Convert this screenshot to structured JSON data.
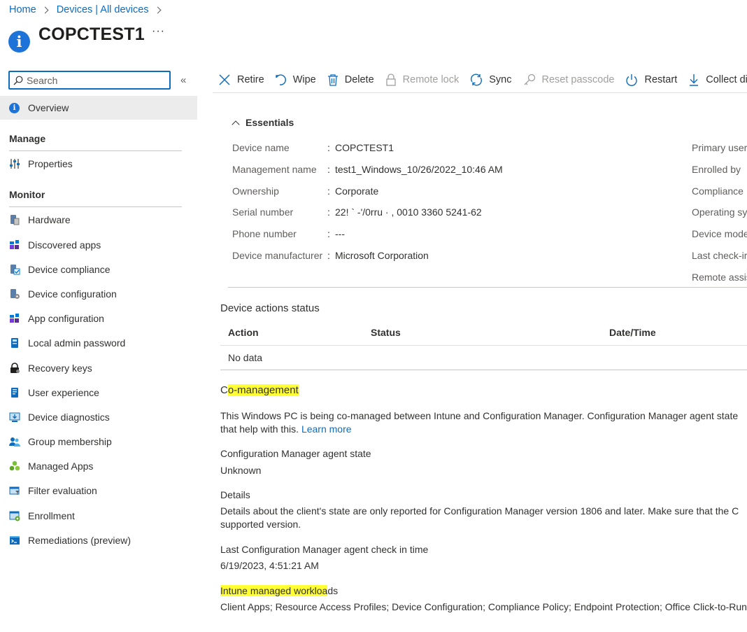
{
  "breadcrumb": {
    "home": "Home",
    "devices": "Devices | All devices"
  },
  "title": "COPCTEST1",
  "more_label": "···",
  "search": {
    "placeholder": "Search"
  },
  "collapse_label": "«",
  "sidebar": {
    "overview": "Overview",
    "manage_label": "Manage",
    "manage_items": [
      "Properties"
    ],
    "monitor_label": "Monitor",
    "monitor_items": [
      "Hardware",
      "Discovered apps",
      "Device compliance",
      "Device configuration",
      "App configuration",
      "Local admin password",
      "Recovery keys",
      "User experience",
      "Device diagnostics",
      "Group membership",
      "Managed Apps",
      "Filter evaluation",
      "Enrollment",
      "Remediations (preview)"
    ]
  },
  "commands": {
    "retire": "Retire",
    "wipe": "Wipe",
    "delete": "Delete",
    "remote_lock": "Remote lock",
    "sync": "Sync",
    "reset_passcode": "Reset passcode",
    "restart": "Restart",
    "collect": "Collect dia"
  },
  "essentials": {
    "heading": "Essentials",
    "rows": [
      {
        "key": "Device name",
        "value": "COPCTEST1"
      },
      {
        "key": "Management name",
        "value": "test1_Windows_10/26/2022_10:46 AM"
      },
      {
        "key": "Ownership",
        "value": "Corporate"
      },
      {
        "key": "Serial number",
        "value": "22! ` -'/0rru · , 0010 3360 5241-62"
      },
      {
        "key": "Phone number",
        "value": "---"
      },
      {
        "key": "Device manufacturer",
        "value": "Microsoft Corporation"
      }
    ],
    "right": [
      "Primary user",
      "Enrolled by",
      "Compliance",
      "Operating sy",
      "Device mode",
      "Last check-ir",
      "Remote assis"
    ]
  },
  "actions_status": {
    "heading": "Device actions status",
    "columns": [
      "Action",
      "Status",
      "Date/Time"
    ],
    "empty": "No data"
  },
  "comanagement": {
    "heading_prefix": "C",
    "heading_highlight": "o-management",
    "description_line1": "This Windows PC is being co-managed between Intune and Configuration Manager. Configuration Manager agent state",
    "description_line2": "that help with this. ",
    "learn_more": "Learn more",
    "agent_state_label": "Configuration Manager agent state",
    "agent_state_value": "Unknown",
    "details_label": "Details",
    "details_line1": "Details about the client's state are only reported for Configuration Manager version 1806 and later. Make sure that the C",
    "details_line2": "supported version.",
    "last_checkin_label": "Last Configuration Manager agent check in time",
    "last_checkin_value": "6/19/2023, 4:51:21 AM",
    "workloads_highlight": "Intune managed workloa",
    "workloads_suffix": "ds",
    "workloads_value": "Client Apps; Resource Access Profiles; Device Configuration; Compliance Policy; Endpoint Protection; Office Click-to-Run"
  }
}
